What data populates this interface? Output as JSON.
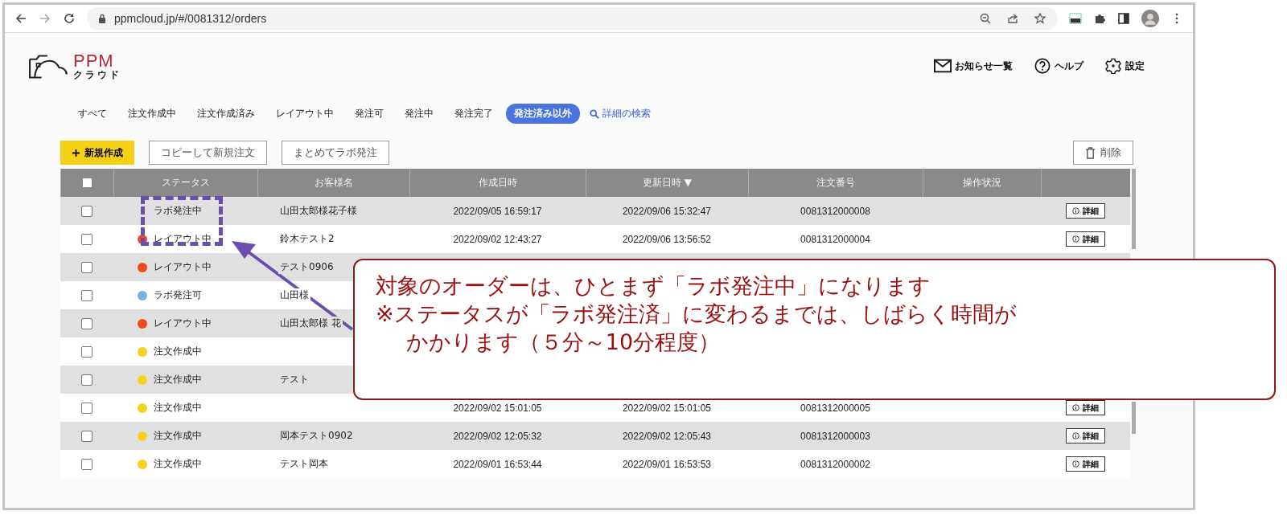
{
  "browser": {
    "url": "ppmcloud.jp/#/0081312/orders"
  },
  "header": {
    "logo_text": "PPM",
    "logo_subtext": "クラウド",
    "links": [
      {
        "label": "お知らせ一覧",
        "kind": "mail"
      },
      {
        "label": "ヘルプ",
        "kind": "help"
      },
      {
        "label": "設定",
        "kind": "settings"
      }
    ]
  },
  "tabs": [
    {
      "label": "すべて",
      "selected": false
    },
    {
      "label": "注文作成中",
      "selected": false
    },
    {
      "label": "注文作成済み",
      "selected": false
    },
    {
      "label": "レイアウト中",
      "selected": false
    },
    {
      "label": "発注可",
      "selected": false
    },
    {
      "label": "発注中",
      "selected": false
    },
    {
      "label": "発注完了",
      "selected": false
    },
    {
      "label": "発注済み以外",
      "selected": true
    }
  ],
  "search_link": "詳細の検索",
  "actions": {
    "new": "新規作成",
    "copy": "コピーして新規注文",
    "bulk": "まとめてラボ発注",
    "delete": "削除"
  },
  "table": {
    "select_all_checked": false,
    "columns": [
      "ステータス",
      "お客様名",
      "作成日時",
      "更新日時 ▼",
      "注文番号",
      "操作状況"
    ],
    "rows": [
      {
        "checked": false,
        "status": "ラボ発注中",
        "customer": "山田太郎様花子様",
        "created": "2022/09/05 16:59:17",
        "updated": "2022/09/06 15:32:47",
        "order": "0081312000008",
        "detail": "詳細"
      },
      {
        "checked": false,
        "status": "レイアウト中",
        "color": "#f04a1e",
        "customer": "鈴木テスト2",
        "created": "2022/09/02 12:43:27",
        "updated": "2022/09/06 13:56:52",
        "order": "0081312000004",
        "detail": "詳細"
      },
      {
        "checked": false,
        "status": "レイアウト中",
        "color": "#f04a1e",
        "customer": "テスト0906"
      },
      {
        "checked": false,
        "status": "ラボ発注可",
        "color": "#7bb0de",
        "customer": "山田様"
      },
      {
        "checked": false,
        "status": "レイアウト中",
        "color": "#f04a1e",
        "customer": "山田太郎様 花"
      },
      {
        "checked": false,
        "status": "注文作成中",
        "color": "#f5d31d"
      },
      {
        "checked": false,
        "status": "注文作成中",
        "color": "#f5d31d",
        "customer": "テスト"
      },
      {
        "checked": false,
        "status": "注文作成中",
        "color": "#f5d31d",
        "created": "2022/09/02 15:01:05",
        "updated": "2022/09/02 15:01:05",
        "order": "0081312000005",
        "detail": "詳細"
      },
      {
        "checked": false,
        "status": "注文作成中",
        "color": "#f5d31d",
        "customer": "岡本テスト0902",
        "created": "2022/09/02 12:05:32",
        "updated": "2022/09/02 12:05:43",
        "order": "0081312000003",
        "detail": "詳細"
      },
      {
        "checked": false,
        "status": "注文作成中",
        "color": "#f5d31d",
        "customer": "テスト岡本",
        "created": "2022/09/01 16:53:44",
        "updated": "2022/09/01 16:53:53",
        "order": "0081312000002",
        "detail": "詳細"
      }
    ]
  },
  "callout": {
    "lines": [
      "対象のオーダーは、ひとまず「ラボ発注中」になります",
      "※ステータスが「ラボ発注済」に変わるまでは、しばらく時間が",
      "かかります（５分～10分程度）"
    ]
  }
}
